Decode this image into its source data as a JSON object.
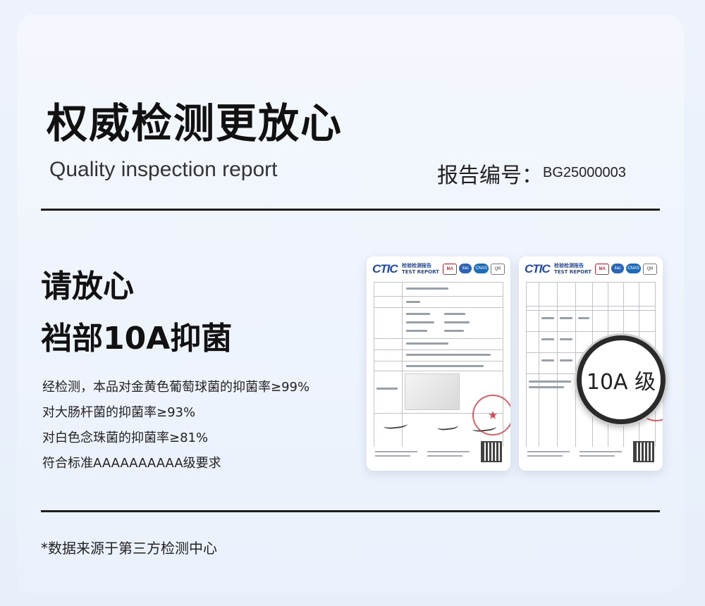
{
  "header": {
    "title": "权威检测更放心",
    "subtitle": "Quality inspection report",
    "report_label": "报告编号：",
    "report_number": "BG25000003"
  },
  "main": {
    "heading_line1": "请放心",
    "heading_line2": "裆部10A抑菌",
    "claims": [
      "经检测，本品对金黄色葡萄球菌的抑菌率≥99%",
      "对大肠杆菌的抑菌率≥93%",
      "对白色念珠菌的抑菌率≥81%",
      "符合标准AAAAAAAAAA级要求"
    ]
  },
  "documents": {
    "logo_text": "CTIC",
    "logo_sub_cn": "检验检测报告",
    "logo_sub_en": "TEST REPORT",
    "badges": [
      "MA",
      "ilac",
      "CNAS",
      "QR"
    ],
    "magnifier_text": "10A 级"
  },
  "footer": {
    "note": "*数据来源于第三方检测中心"
  }
}
